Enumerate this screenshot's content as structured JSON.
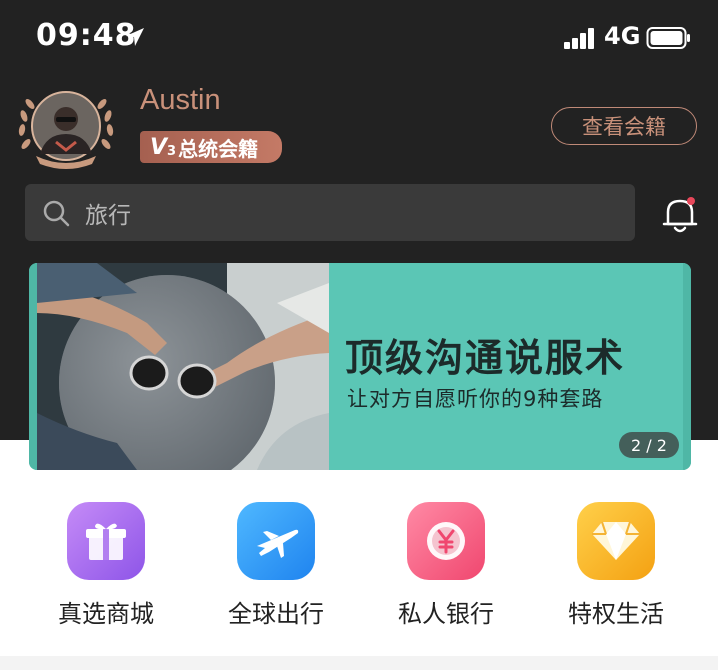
{
  "status_bar": {
    "time": "09:48",
    "network": "4G"
  },
  "profile": {
    "name": "Austin",
    "badge_level": "V",
    "badge_level_num": "3",
    "badge_label": "总统会籍",
    "view_button": "查看会籍"
  },
  "search": {
    "placeholder": "旅行"
  },
  "banner": {
    "title": "顶级沟通说服术",
    "subtitle": "让对方自愿听你的9种套路",
    "pager": "2 / 2"
  },
  "services": [
    {
      "label": "真选商城",
      "icon": "gift-icon",
      "color": "#a86ef0"
    },
    {
      "label": "全球出行",
      "icon": "plane-icon",
      "color": "#2f9bf5"
    },
    {
      "label": "私人银行",
      "icon": "yen-coin-icon",
      "color": "#f45b87"
    },
    {
      "label": "特权生活",
      "icon": "diamond-icon",
      "color": "#f7b419"
    }
  ],
  "colors": {
    "accent": "#c9917a",
    "dark_bg": "#222222",
    "banner_bg": "#5bc6b5"
  }
}
